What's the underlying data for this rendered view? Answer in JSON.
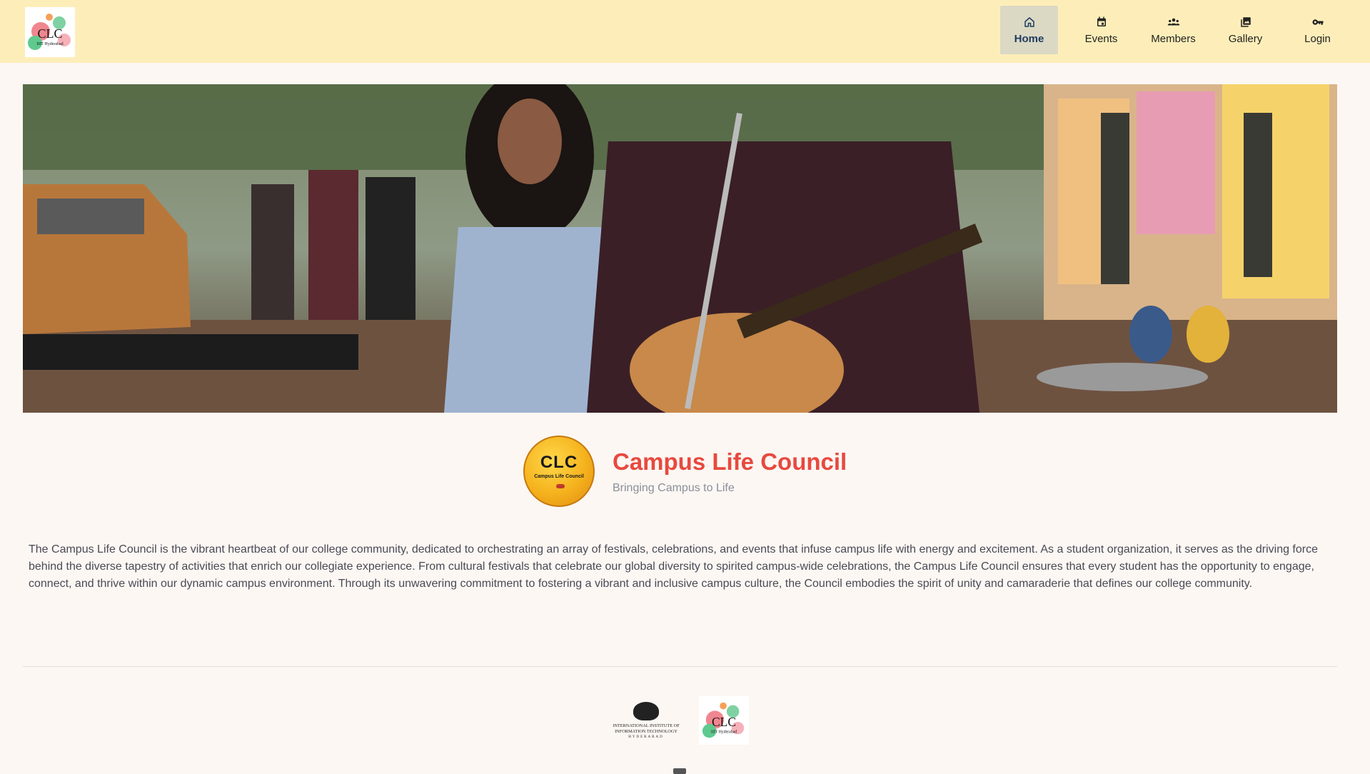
{
  "header": {
    "logo_text": "CLC",
    "logo_subtext": "IIIT Hyderabad",
    "nav": [
      {
        "label": "Home",
        "icon": "home-icon",
        "active": true
      },
      {
        "label": "Events",
        "icon": "calendar-icon",
        "active": false
      },
      {
        "label": "Members",
        "icon": "members-icon",
        "active": false
      },
      {
        "label": "Gallery",
        "icon": "gallery-icon",
        "active": false
      },
      {
        "label": "Login",
        "icon": "key-icon",
        "active": false
      }
    ]
  },
  "hero": {
    "image": "hero-banner-image"
  },
  "intro": {
    "badge_text": "CLC",
    "badge_subtext": "Campus Life Council",
    "title": "Campus Life Council",
    "tagline": "Bringing Campus to Life",
    "description": "The Campus Life Council is the vibrant heartbeat of our college community, dedicated to orchestrating an array of festivals, celebrations, and events that infuse campus life with energy and excitement. As a student organization, it serves as the driving force behind the diverse tapestry of activities that enrich our collegiate experience. From cultural festivals that celebrate our global diversity to spirited campus-wide celebrations, the Campus Life Council ensures that every student has the opportunity to engage, connect, and thrive within our dynamic campus environment. Through its unwavering commitment to fostering a vibrant and inclusive campus culture, the Council embodies the spirit of unity and camaraderie that defines our college community."
  },
  "footer": {
    "iiit_line1": "INTERNATIONAL INSTITUTE OF",
    "iiit_line2": "INFORMATION TECHNOLOGY",
    "iiit_line3": "HYDERABAD",
    "clc_text": "CLC",
    "clc_subtext": "IIIT Hyderabad"
  },
  "colors": {
    "header_bg": "#fdeeb9",
    "active_nav_bg": "#dbd9c4",
    "title_accent": "#e8493f",
    "page_bg": "#fcf7f3"
  }
}
